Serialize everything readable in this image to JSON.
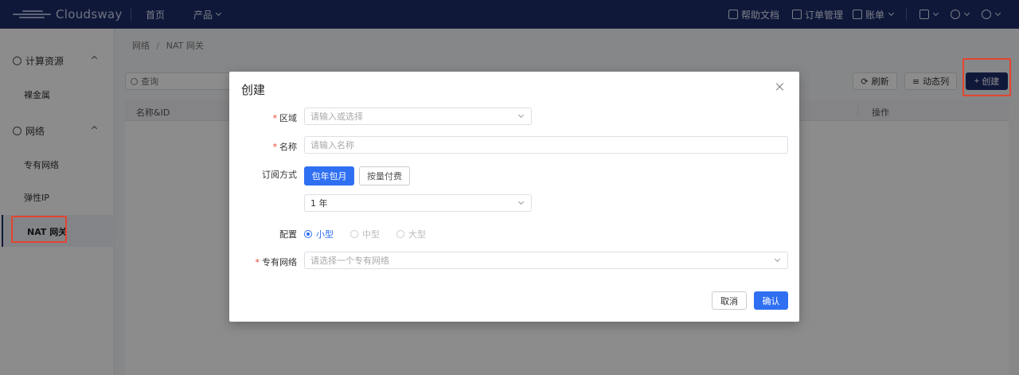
{
  "topbar": {
    "logo_text": "Cloudsway",
    "nav": [
      {
        "label": "首页"
      },
      {
        "label": "产品"
      }
    ],
    "right": [
      {
        "label": "帮助文档"
      },
      {
        "label": "订单管理"
      },
      {
        "label": "账单"
      }
    ]
  },
  "sidebar": {
    "groups": [
      {
        "label": "计算资源",
        "items": [
          "裸金属"
        ]
      },
      {
        "label": "网络",
        "items": [
          "专有网络",
          "弹性IP",
          "NAT 网关"
        ]
      }
    ],
    "active": "NAT 网关"
  },
  "breadcrumb": {
    "parent": "网络",
    "sep": "/",
    "current": "NAT 网关"
  },
  "toolbar": {
    "search_placeholder": "查询",
    "refresh_label": "刷新",
    "columns_label": "动态列",
    "create_label": "创建"
  },
  "table": {
    "headers": [
      "名称&ID",
      "操作"
    ]
  },
  "modal": {
    "title": "创建",
    "fields": {
      "region": {
        "label": "区域",
        "placeholder": "请输入或选择"
      },
      "name": {
        "label": "名称",
        "placeholder": "请输入名称"
      },
      "billing": {
        "label": "订阅方式",
        "options": [
          "包年包月",
          "按量付费"
        ],
        "selected": "包年包月"
      },
      "period": {
        "value": "1 年"
      },
      "config": {
        "label": "配置",
        "options": [
          "小型",
          "中型",
          "大型"
        ],
        "selected": "小型"
      },
      "vpc": {
        "label": "专有网络",
        "placeholder": "请选择一个专有网络"
      }
    },
    "cancel_label": "取消",
    "confirm_label": "确认"
  },
  "colors": {
    "topbar": "#1e2d6b",
    "primary": "#2f6ff2",
    "highlight": "#e5442f"
  }
}
